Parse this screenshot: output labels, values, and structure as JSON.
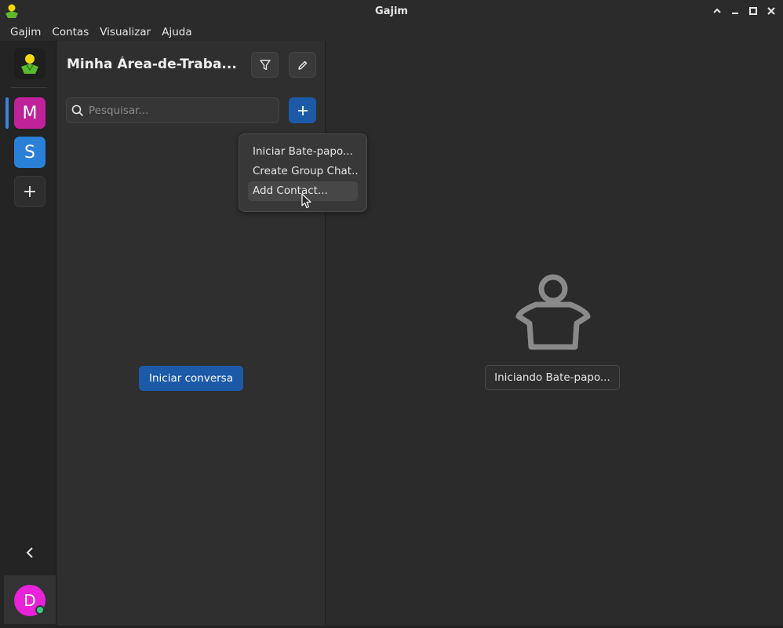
{
  "window": {
    "title": "Gajim"
  },
  "menubar": {
    "items": [
      "Gajim",
      "Contas",
      "Visualizar",
      "Ajuda"
    ]
  },
  "rail": {
    "workspaces": [
      {
        "letter": "M",
        "color": "#c0229a"
      },
      {
        "letter": "S",
        "color": "#2a7fd6"
      }
    ],
    "add_symbol": "+",
    "account_letter": "D",
    "account_color": "#e822d8",
    "status_color": "#33d17a"
  },
  "chat_list": {
    "title": "Minha Área-de-Traba...",
    "search_placeholder": "Pesquisar...",
    "start_button": "Iniciar conversa"
  },
  "popover": {
    "items": [
      {
        "label": "Iniciar Bate-papo..."
      },
      {
        "label": "Create Group Chat..."
      },
      {
        "label": "Add Contact..."
      }
    ],
    "hovered_index": 2
  },
  "main": {
    "status_button": "Iniciando Bate-papo..."
  },
  "colors": {
    "accent": "#1c5aa8",
    "indicator": "#3584e4"
  }
}
